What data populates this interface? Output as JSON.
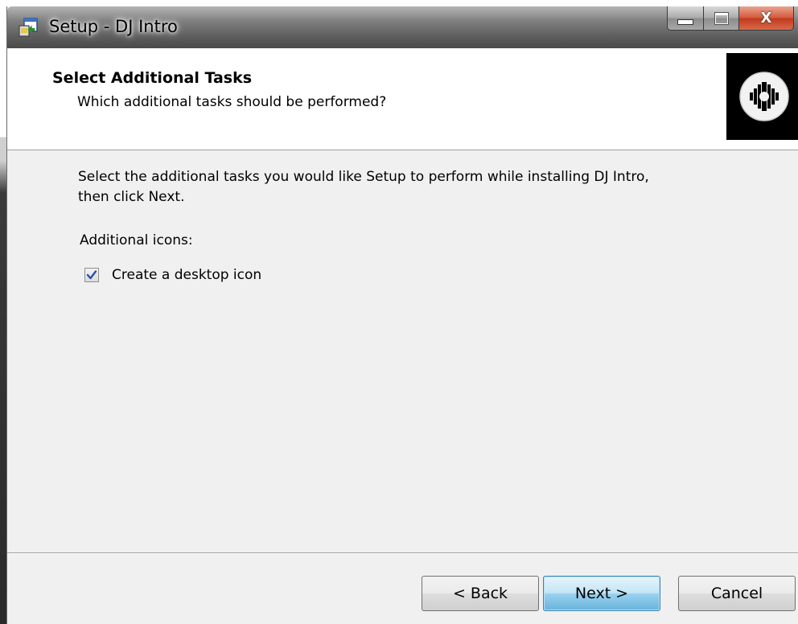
{
  "window": {
    "title": "Setup - DJ Intro",
    "icon": "setup-installer-icon",
    "close_glyph": "X"
  },
  "header": {
    "title": "Select Additional Tasks",
    "subtitle": "Which additional tasks should be performed?",
    "logo": "dj-record-logo"
  },
  "body": {
    "instruction_line1": "Select the additional tasks you would like Setup to perform while installing DJ Intro,",
    "instruction_line2": "then click Next.",
    "group_label": "Additional icons:",
    "tasks": [
      {
        "label": "Create a desktop icon",
        "checked": true
      }
    ]
  },
  "buttons": {
    "back": "< Back",
    "next": "Next >",
    "cancel": "Cancel"
  },
  "colors": {
    "header_bg": "#ffffff",
    "body_bg": "#f0f0f0",
    "close_red": "#c1391b",
    "default_button_blue": "#98d1ef"
  }
}
